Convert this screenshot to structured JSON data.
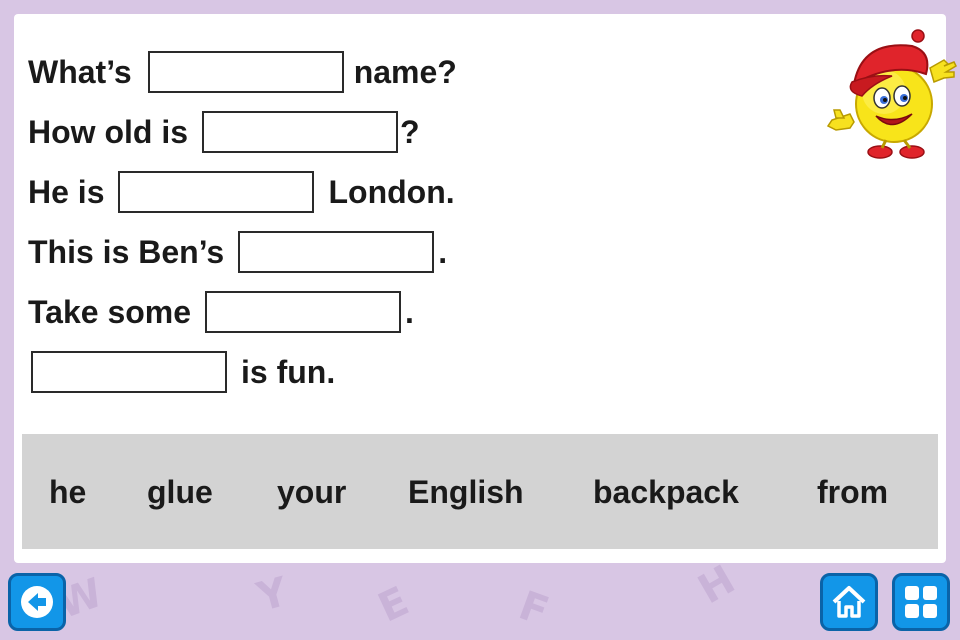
{
  "exercise": {
    "sentences": [
      {
        "before": "What’s",
        "after": "name?"
      },
      {
        "before": "How old is",
        "after": "?"
      },
      {
        "before": "He is",
        "after": "London."
      },
      {
        "before": "This is Ben’s",
        "after": "."
      },
      {
        "before": "Take some",
        "after": "."
      },
      {
        "before": "",
        "after": "is fun."
      }
    ]
  },
  "word_bank": [
    "he",
    "glue",
    "your",
    "English",
    "backpack",
    "from"
  ],
  "background_letters": [
    "Y",
    "E",
    "F",
    "H",
    "W"
  ],
  "icons": {
    "mascot": "smiley-mascot-icon",
    "back": "back-arrow-icon",
    "home": "home-icon",
    "menu": "grid-menu-icon"
  },
  "colors": {
    "background": "#d8c6e4",
    "card": "#ffffff",
    "word_bank": "#d3d3d3",
    "button": "#1296e8"
  }
}
